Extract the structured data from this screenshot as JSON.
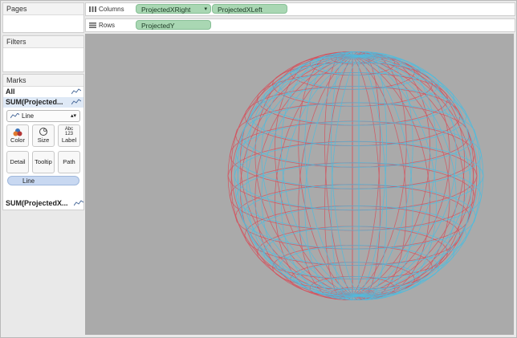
{
  "left": {
    "pages_title": "Pages",
    "filters_title": "Filters",
    "marks_title": "Marks",
    "marks_rows": [
      {
        "label": "All",
        "icon": "line-mark-icon"
      },
      {
        "label": "SUM(Projected...",
        "icon": "line-mark-icon"
      }
    ],
    "mark_type": "Line",
    "buttons": {
      "color": "Color",
      "size": "Size",
      "label": "Label",
      "detail": "Detail",
      "tooltip": "Tooltip",
      "path": "Path"
    },
    "label_icon_text": "Abc\n123",
    "line_pill": "Line",
    "bottom_mark": "SUM(ProjectedX..."
  },
  "shelves": {
    "columns_label": "Columns",
    "rows_label": "Rows",
    "columns_pills": [
      "ProjectedXRight",
      "ProjectedXLeft"
    ],
    "rows_pills": [
      "ProjectedY"
    ]
  },
  "viz": {
    "background": "#aaaaaa",
    "red_line_color": "#d4525e",
    "blue_line_color": "#4fbcde"
  }
}
